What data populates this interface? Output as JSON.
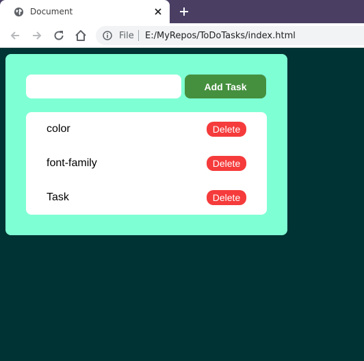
{
  "browser": {
    "tab": {
      "title": "Document",
      "favicon": "globe-icon",
      "close_icon": "close-icon"
    },
    "new_tab_icon": "plus-icon",
    "nav": {
      "back_icon": "back-arrow-icon",
      "forward_icon": "forward-arrow-icon",
      "reload_icon": "reload-icon",
      "home_icon": "home-icon"
    },
    "omnibox": {
      "info_icon": "info-icon",
      "scheme": "File",
      "url": "E:/MyRepos/ToDoTasks/index.html"
    },
    "colors": {
      "tabstrip": "#4a3f63",
      "page_background": "#003333"
    }
  },
  "app": {
    "input": {
      "value": "",
      "placeholder": ""
    },
    "add_button_label": "Add Task",
    "tasks": [
      {
        "text": "color",
        "delete_label": "Delete"
      },
      {
        "text": "font-family",
        "delete_label": "Delete"
      },
      {
        "text": "Task",
        "delete_label": "Delete"
      }
    ],
    "colors": {
      "card": "#7fffd4",
      "add_button": "#45903f",
      "delete_button": "#f53b3b"
    }
  }
}
